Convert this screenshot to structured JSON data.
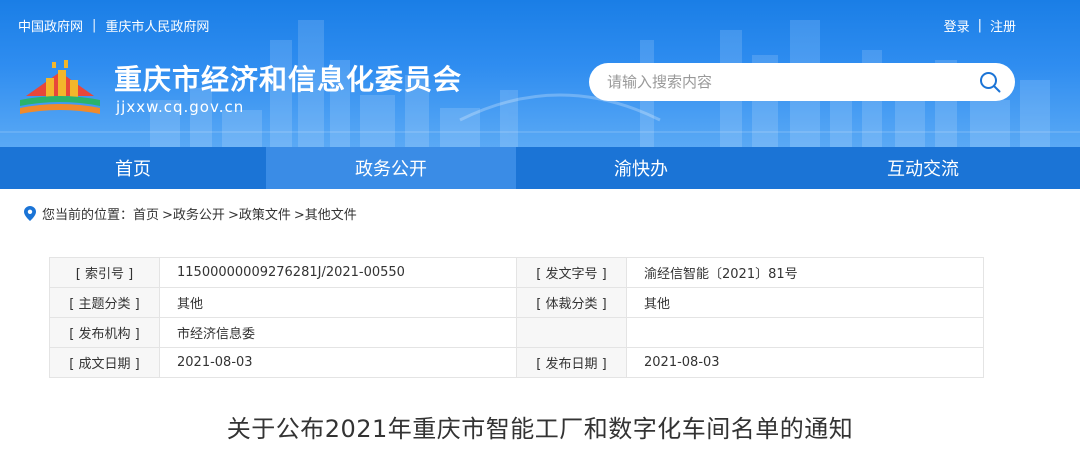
{
  "top_links": {
    "gov": "中国政府网",
    "city": "重庆市人民政府网",
    "sep": "|"
  },
  "auth": {
    "login": "登录",
    "register": "注册",
    "sep": "|"
  },
  "site": {
    "title": "重庆市经济和信息化委员会",
    "domain": "jjxxw.cq.gov.cn"
  },
  "search": {
    "placeholder": "请输入搜索内容"
  },
  "nav": [
    {
      "label": "首页"
    },
    {
      "label": "政务公开"
    },
    {
      "label": "渝快办"
    },
    {
      "label": "互动交流"
    }
  ],
  "breadcrumb": {
    "prefix": "您当前的位置：",
    "items": [
      "首页",
      ">政务公开",
      ">政策文件",
      ">其他文件"
    ]
  },
  "info": {
    "rows": [
      {
        "k1": "[ 索引号 ]",
        "v1": "11500000009276281J/2021-00550",
        "k2": "[ 发文字号 ]",
        "v2": "渝经信智能〔2021〕81号"
      },
      {
        "k1": "[ 主题分类 ]",
        "v1": "其他",
        "k2": "[ 体裁分类 ]",
        "v2": "其他"
      },
      {
        "k1": "[ 发布机构 ]",
        "v1": "市经济信息委",
        "k2": "",
        "v2": ""
      },
      {
        "k1": "[ 成文日期 ]",
        "v1": "2021-08-03",
        "k2": "[ 发布日期 ]",
        "v2": "2021-08-03"
      }
    ]
  },
  "doc_title": "关于公布2021年重庆市智能工厂和数字化车间名单的通知",
  "colors": {
    "header": "#2f8df0",
    "nav": "#1b74d6",
    "nav_active": "#3a8ce6"
  }
}
